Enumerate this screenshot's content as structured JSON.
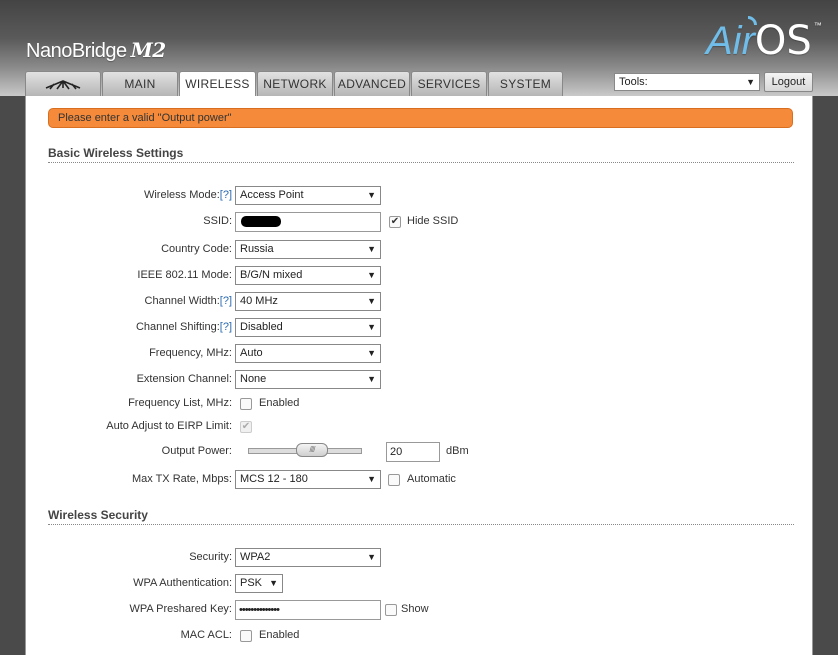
{
  "header": {
    "brand": "NanoBridge",
    "model": "M2",
    "logo_air": "Air",
    "logo_os": "OS",
    "logo_tm": "™"
  },
  "tabs": [
    {
      "label": "",
      "icon": "ubiquiti-logo-icon"
    },
    {
      "label": "MAIN"
    },
    {
      "label": "WIRELESS",
      "active": true
    },
    {
      "label": "NETWORK"
    },
    {
      "label": "ADVANCED"
    },
    {
      "label": "SERVICES"
    },
    {
      "label": "SYSTEM"
    }
  ],
  "tools": {
    "label": "Tools:"
  },
  "logout": "Logout",
  "error": "Please enter a valid \"Output power\"",
  "basic": {
    "title": "Basic Wireless Settings",
    "wireless_mode": {
      "label": "Wireless Mode:",
      "help": "[?]",
      "value": "Access Point"
    },
    "ssid": {
      "label": "SSID:",
      "hide_label": "Hide SSID",
      "hide_checked": true
    },
    "country": {
      "label": "Country Code:",
      "value": "Russia"
    },
    "ieee": {
      "label": "IEEE 802.11 Mode:",
      "value": "B/G/N mixed"
    },
    "channel_width": {
      "label": "Channel Width:",
      "help": "[?]",
      "value": "40 MHz"
    },
    "channel_shifting": {
      "label": "Channel Shifting:",
      "help": "[?]",
      "value": "Disabled"
    },
    "frequency": {
      "label": "Frequency, MHz:",
      "value": "Auto"
    },
    "extension": {
      "label": "Extension Channel:",
      "value": "None"
    },
    "freq_list": {
      "label": "Frequency List, MHz:",
      "cb_label": "Enabled",
      "checked": false
    },
    "eirp": {
      "label": "Auto Adjust to EIRP Limit:",
      "checked": true
    },
    "output_power": {
      "label": "Output Power:",
      "value": "20",
      "unit": "dBm",
      "handle_glyph": "////"
    },
    "max_tx": {
      "label": "Max TX Rate, Mbps:",
      "value": "MCS 12 - 180",
      "auto_label": "Automatic",
      "auto_checked": false
    }
  },
  "security": {
    "title": "Wireless Security",
    "security": {
      "label": "Security:",
      "value": "WPA2"
    },
    "wpa_auth": {
      "label": "WPA Authentication:",
      "value": "PSK"
    },
    "wpa_key": {
      "label": "WPA Preshared Key:",
      "value": "••••••••••••••",
      "show_label": "Show",
      "show_checked": false
    },
    "mac_acl": {
      "label": "MAC ACL:",
      "cb_label": "Enabled",
      "checked": false
    }
  }
}
